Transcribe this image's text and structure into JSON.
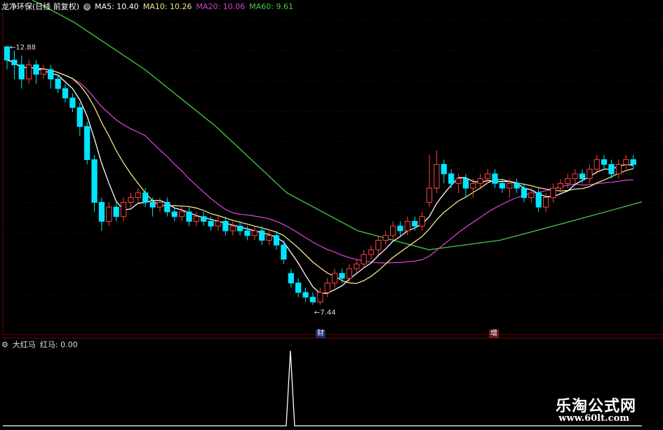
{
  "header": {
    "stock_title": "龙净环保(日线 前复权)",
    "ma_labels": [
      {
        "text": "MA5: 10.40",
        "color": "#ffffff"
      },
      {
        "text": "MA10: 10.26",
        "color": "#f0e68c"
      },
      {
        "text": "MA20: 10.06",
        "color": "#cc44cc"
      },
      {
        "text": "MA60: 9.61",
        "color": "#44cc44"
      }
    ]
  },
  "indicator": {
    "title": "大红马",
    "value_label": "红马: 0.00"
  },
  "events": {
    "cai": "财",
    "zeng": "增"
  },
  "annotations": {
    "high_label": "12.88",
    "low_label": "7.44"
  },
  "watermark": {
    "line1": "乐淘公式网",
    "line2": "www.60lt.com"
  },
  "colors": {
    "up": "#ff4444",
    "down": "#00e5ff",
    "ma5": "#ffffff",
    "ma10": "#f0e68c",
    "ma20": "#cc44cc",
    "ma60": "#44cc44",
    "grid": "#7a0000",
    "indicator_line": "#ffffff"
  },
  "chart_data": {
    "type": "candlestick",
    "ma60_values": [
      14.2,
      13.4,
      12.4,
      11.2,
      9.8,
      9.0,
      8.6,
      8.8,
      9.2,
      9.61
    ],
    "indicator_values": [
      0,
      0,
      0,
      0,
      1,
      0,
      0,
      0,
      0,
      0
    ],
    "candles": [
      [
        12.88,
        12.6,
        12.9,
        12.4
      ],
      [
        12.6,
        12.5,
        12.8,
        12.2
      ],
      [
        12.5,
        12.2,
        12.7,
        12.0
      ],
      [
        12.2,
        12.5,
        12.6,
        12.1
      ],
      [
        12.5,
        12.3,
        12.6,
        12.1
      ],
      [
        12.3,
        12.4,
        12.5,
        12.2
      ],
      [
        12.4,
        12.2,
        12.5,
        12.0
      ],
      [
        12.2,
        12.0,
        12.3,
        11.9
      ],
      [
        12.0,
        11.8,
        12.1,
        11.7
      ],
      [
        11.8,
        11.6,
        11.9,
        11.5
      ],
      [
        11.6,
        11.2,
        11.7,
        11.0
      ],
      [
        11.2,
        10.5,
        11.3,
        10.4
      ],
      [
        10.5,
        9.6,
        10.6,
        9.4
      ],
      [
        9.6,
        9.2,
        9.7,
        9.0
      ],
      [
        9.2,
        9.5,
        9.6,
        9.1
      ],
      [
        9.5,
        9.3,
        9.6,
        9.2
      ],
      [
        9.3,
        9.6,
        9.7,
        9.2
      ],
      [
        9.6,
        9.7,
        9.8,
        9.5
      ],
      [
        9.7,
        9.8,
        9.9,
        9.6
      ],
      [
        9.8,
        9.6,
        9.9,
        9.5
      ],
      [
        9.6,
        9.5,
        9.7,
        9.3
      ],
      [
        9.5,
        9.6,
        9.7,
        9.4
      ],
      [
        9.6,
        9.4,
        9.7,
        9.3
      ],
      [
        9.4,
        9.3,
        9.5,
        9.2
      ],
      [
        9.3,
        9.4,
        9.5,
        9.2
      ],
      [
        9.4,
        9.2,
        9.5,
        9.1
      ],
      [
        9.2,
        9.3,
        9.4,
        9.1
      ],
      [
        9.3,
        9.2,
        9.4,
        9.1
      ],
      [
        9.2,
        9.1,
        9.3,
        9.0
      ],
      [
        9.1,
        9.2,
        9.3,
        9.0
      ],
      [
        9.2,
        9.0,
        9.3,
        8.9
      ],
      [
        9.0,
        9.1,
        9.2,
        8.9
      ],
      [
        9.1,
        9.0,
        9.2,
        8.9
      ],
      [
        9.0,
        8.9,
        9.1,
        8.8
      ],
      [
        8.9,
        9.0,
        9.1,
        8.8
      ],
      [
        9.0,
        8.8,
        9.1,
        8.7
      ],
      [
        8.8,
        8.9,
        9.0,
        8.7
      ],
      [
        8.9,
        8.7,
        9.0,
        8.6
      ],
      [
        8.7,
        8.4,
        8.8,
        8.3
      ],
      [
        8.1,
        7.9,
        8.2,
        7.8
      ],
      [
        7.9,
        7.7,
        8.0,
        7.6
      ],
      [
        7.7,
        7.6,
        7.8,
        7.5
      ],
      [
        7.6,
        7.5,
        7.7,
        7.44
      ],
      [
        7.5,
        7.7,
        7.8,
        7.44
      ],
      [
        7.7,
        7.9,
        8.0,
        7.6
      ],
      [
        7.9,
        8.1,
        8.2,
        7.8
      ],
      [
        8.1,
        8.0,
        8.2,
        7.9
      ],
      [
        8.0,
        8.2,
        8.3,
        7.9
      ],
      [
        8.2,
        8.3,
        8.4,
        8.1
      ],
      [
        8.3,
        8.5,
        8.6,
        8.2
      ],
      [
        8.5,
        8.6,
        8.7,
        8.4
      ],
      [
        8.6,
        8.8,
        8.9,
        8.5
      ],
      [
        8.8,
        8.9,
        9.0,
        8.7
      ],
      [
        8.9,
        9.1,
        9.2,
        8.8
      ],
      [
        9.1,
        9.0,
        9.2,
        8.9
      ],
      [
        9.0,
        9.2,
        9.3,
        8.9
      ],
      [
        9.2,
        9.1,
        9.3,
        9.0
      ],
      [
        9.1,
        9.3,
        9.4,
        9.0
      ],
      [
        9.6,
        9.9,
        10.6,
        9.5
      ],
      [
        9.9,
        10.4,
        10.7,
        9.8
      ],
      [
        10.4,
        10.2,
        10.5,
        10.0
      ],
      [
        10.2,
        10.0,
        10.3,
        9.9
      ],
      [
        10.0,
        10.1,
        10.2,
        9.8
      ],
      [
        10.1,
        9.9,
        10.2,
        9.7
      ],
      [
        9.9,
        10.0,
        10.1,
        9.7
      ],
      [
        10.0,
        10.1,
        10.2,
        9.9
      ],
      [
        10.1,
        10.2,
        10.3,
        10.0
      ],
      [
        10.2,
        10.0,
        10.3,
        9.9
      ],
      [
        10.0,
        9.9,
        10.1,
        9.8
      ],
      [
        9.9,
        10.0,
        10.1,
        9.7
      ],
      [
        10.0,
        9.9,
        10.1,
        9.8
      ],
      [
        9.9,
        9.7,
        10.0,
        9.6
      ],
      [
        9.7,
        9.8,
        9.9,
        9.6
      ],
      [
        9.8,
        9.5,
        9.9,
        9.4
      ],
      [
        9.5,
        9.7,
        9.8,
        9.4
      ],
      [
        9.7,
        9.9,
        10.0,
        9.6
      ],
      [
        9.9,
        10.0,
        10.1,
        9.8
      ],
      [
        10.0,
        10.1,
        10.2,
        9.9
      ],
      [
        10.1,
        10.2,
        10.3,
        10.0
      ],
      [
        10.2,
        10.1,
        10.3,
        10.0
      ],
      [
        10.1,
        10.3,
        10.4,
        10.0
      ],
      [
        10.3,
        10.5,
        10.6,
        10.2
      ],
      [
        10.5,
        10.4,
        10.6,
        10.3
      ],
      [
        10.4,
        10.2,
        10.5,
        10.1
      ],
      [
        10.2,
        10.4,
        10.5,
        10.1
      ],
      [
        10.4,
        10.5,
        10.6,
        10.3
      ],
      [
        10.5,
        10.4,
        10.6,
        10.3
      ]
    ]
  }
}
